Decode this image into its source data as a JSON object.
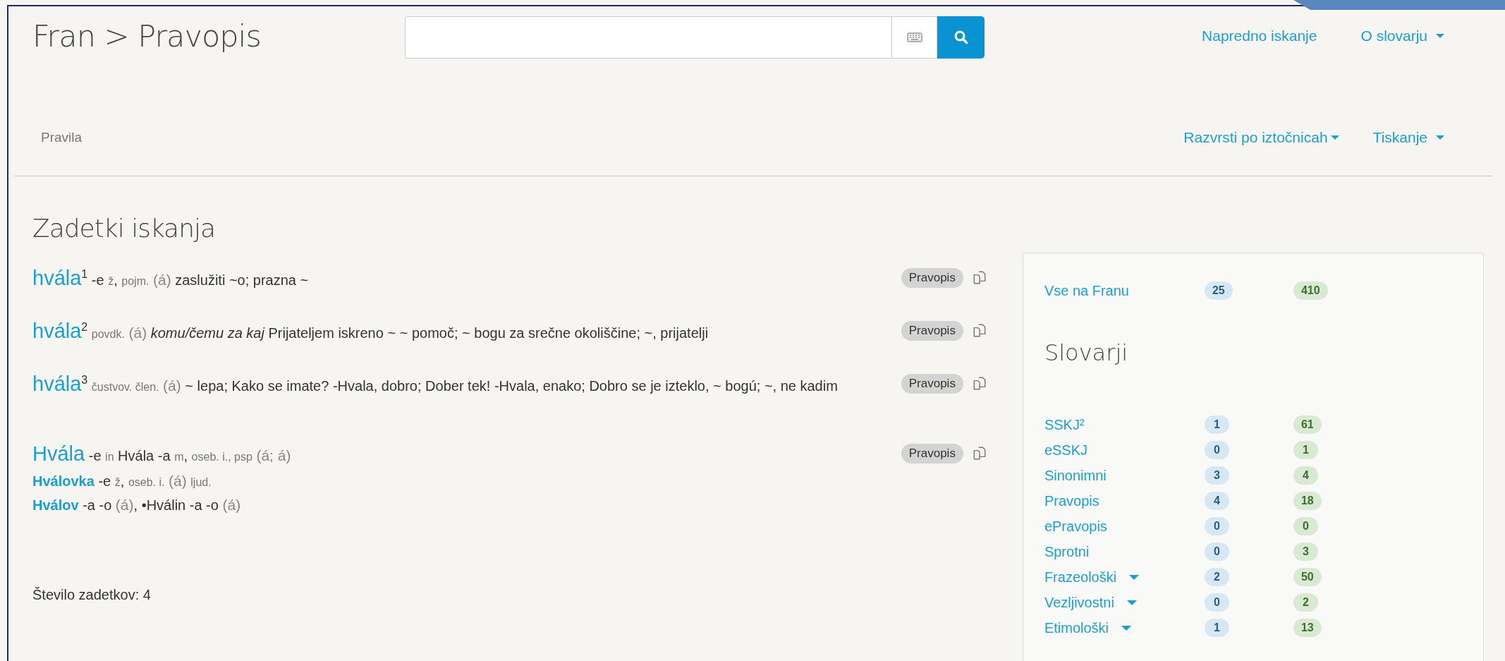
{
  "header": {
    "title": "Fran > Pravopis",
    "links": [
      {
        "label": "Napredno iskanje",
        "caret": false
      },
      {
        "label": "O slovarju",
        "caret": true
      }
    ]
  },
  "subnav": {
    "left": "Pravila",
    "links": [
      {
        "label": "Razvrsti po iztočnicah",
        "caret": true
      },
      {
        "label": "Tiskanje",
        "caret": true
      }
    ]
  },
  "results": {
    "heading": "Zadetki iskanja",
    "entries": [
      {
        "headword": "hvála",
        "homonym": "1",
        "segments": [
          {
            "kind": "plain",
            "text": "-e"
          },
          {
            "kind": "label",
            "text": "ž"
          },
          {
            "kind": "plain",
            "text": ","
          },
          {
            "kind": "label",
            "text": "pojm."
          },
          {
            "kind": "pron",
            "text": "(á)"
          },
          {
            "kind": "plain",
            "text": "zaslužiti ~o; prazna ~"
          }
        ],
        "tag": "Pravopis"
      },
      {
        "headword": "hvála",
        "homonym": "2",
        "segments": [
          {
            "kind": "label",
            "text": "povdk."
          },
          {
            "kind": "pron",
            "text": "(á)"
          },
          {
            "kind": "italic",
            "text": "komu/čemu za kaj"
          },
          {
            "kind": "plain",
            "text": "Prijateljem iskreno ~ ~ pomoč; ~ bogu za srečne okoliščine; ~, prijatelji"
          }
        ],
        "tag": "Pravopis"
      },
      {
        "headword": "hvála",
        "homonym": "3",
        "segments": [
          {
            "kind": "label",
            "text": "čustvov. člen."
          },
          {
            "kind": "pron",
            "text": "(á)"
          },
          {
            "kind": "plain",
            "text": "~ lepa; Kako se imate? -Hvala, dobro; Dober tek! -Hvala, enako; Dobro se je izteklo, ~ bogú; ~, ne kadim"
          }
        ],
        "tag": "Pravopis"
      },
      {
        "headword": "Hvála",
        "segments": [
          {
            "kind": "plain",
            "text": "-e"
          },
          {
            "kind": "label",
            "text": "in"
          },
          {
            "kind": "plain",
            "text": "Hvála -a"
          },
          {
            "kind": "label",
            "text": "m"
          },
          {
            "kind": "plain",
            "text": ","
          },
          {
            "kind": "label",
            "text": "oseb. i., psp"
          },
          {
            "kind": "pron",
            "text": "(á; á)"
          }
        ],
        "tag": "Pravopis",
        "sublines": [
          {
            "headword": "Hválovka",
            "segments": [
              {
                "kind": "plain",
                "text": "-e"
              },
              {
                "kind": "label",
                "text": "ž"
              },
              {
                "kind": "plain",
                "text": ","
              },
              {
                "kind": "label",
                "text": "oseb. i."
              },
              {
                "kind": "pron",
                "text": "(á)"
              },
              {
                "kind": "label",
                "text": "ljud."
              }
            ]
          },
          {
            "headword": "Hválov",
            "segments": [
              {
                "kind": "plain",
                "text": "-a -o"
              },
              {
                "kind": "pron",
                "text": "(á)"
              },
              {
                "kind": "plain",
                "text": ", •Hválin -a -o"
              },
              {
                "kind": "pron",
                "text": "(á)"
              }
            ]
          }
        ]
      }
    ],
    "count": "Število zadetkov: 4"
  },
  "sidebar": {
    "all": {
      "label": "Vse na Franu",
      "hits": "25",
      "total": "410"
    },
    "heading": "Slovarji",
    "items": [
      {
        "label": "SSKJ²",
        "hits": "1",
        "total": "61",
        "caret": false
      },
      {
        "label": "eSSKJ",
        "hits": "0",
        "total": "1",
        "caret": false
      },
      {
        "label": "Sinonimni",
        "hits": "3",
        "total": "4",
        "caret": false
      },
      {
        "label": "Pravopis",
        "hits": "4",
        "total": "18",
        "caret": false
      },
      {
        "label": "ePravopis",
        "hits": "0",
        "total": "0",
        "caret": false
      },
      {
        "label": "Sprotni",
        "hits": "0",
        "total": "3",
        "caret": false
      },
      {
        "label": "Frazeološki",
        "hits": "2",
        "total": "50",
        "caret": true
      },
      {
        "label": "Vezljivostni",
        "hits": "0",
        "total": "2",
        "caret": true
      },
      {
        "label": "Etimološki",
        "hits": "1",
        "total": "13",
        "caret": true
      }
    ]
  }
}
